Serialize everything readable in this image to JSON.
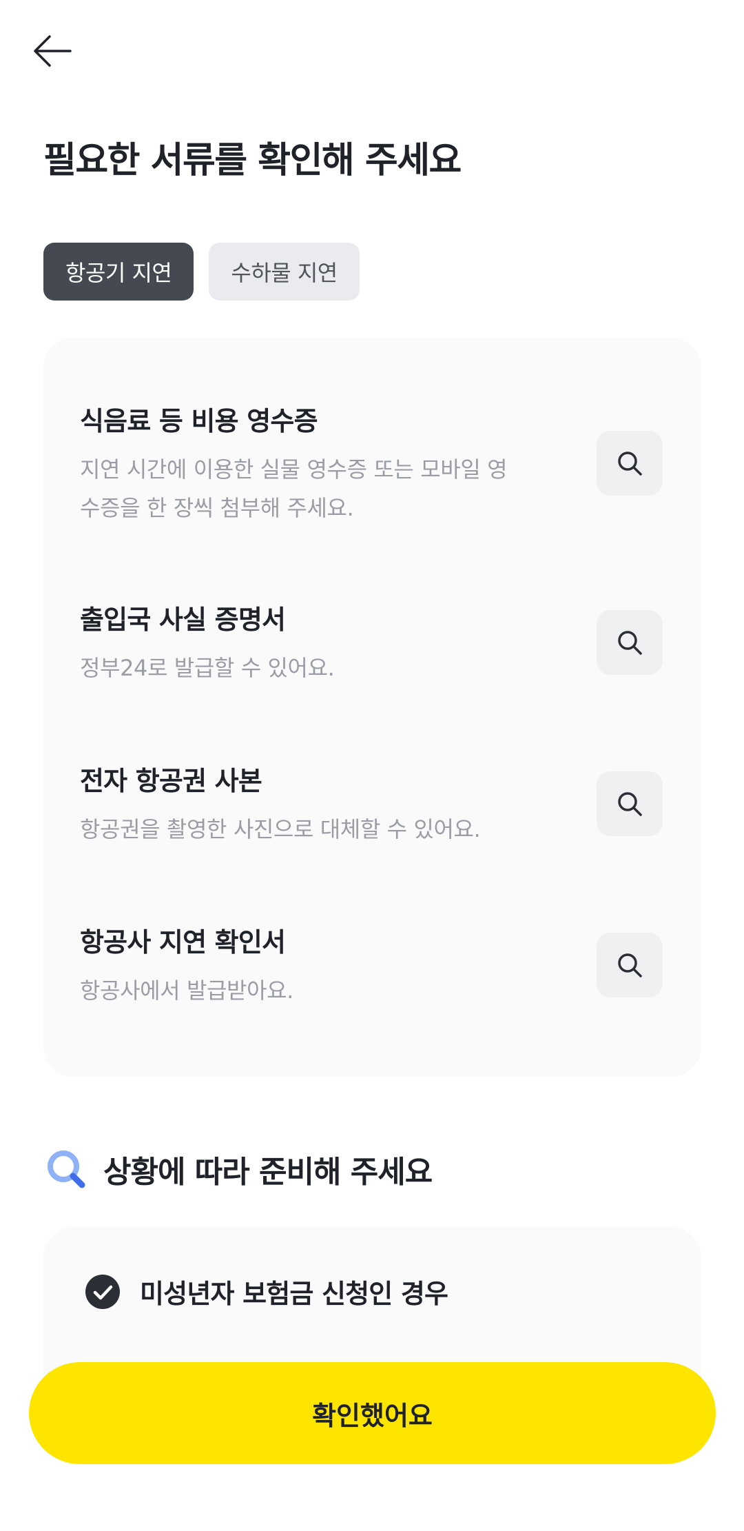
{
  "header": {
    "back_icon": "arrow-left-icon",
    "title": "필요한 서류를 확인해 주세요"
  },
  "tabs": [
    {
      "label": "항공기 지연",
      "selected": true
    },
    {
      "label": "수하물 지연",
      "selected": false
    }
  ],
  "documents": [
    {
      "title": "식음료 등 비용 영수증",
      "desc": "지연 시간에 이용한 실물 영수증 또는 모바일 영수증을 한 장씩 첨부해 주세요.",
      "icon": "search-icon"
    },
    {
      "title": "출입국 사실 증명서",
      "desc": "정부24로 발급할 수 있어요.",
      "icon": "search-icon"
    },
    {
      "title": "전자 항공권 사본",
      "desc": "항공권을 촬영한 사진으로 대체할 수 있어요.",
      "icon": "search-icon"
    },
    {
      "title": "항공사 지연 확인서",
      "desc": "항공사에서 발급받아요.",
      "icon": "search-icon"
    }
  ],
  "conditions": {
    "title": "상황에 따라 준비해 주세요",
    "icon": "magnifier-icon",
    "items": [
      {
        "label": "미성년자 보험금 신청인 경우",
        "icon": "check-circle-icon"
      }
    ]
  },
  "footer": {
    "confirm_label": "확인했어요"
  },
  "colors": {
    "accent": "#fee500",
    "tab_active": "#454a52",
    "tab_inactive": "#e9ebee",
    "card_bg": "#fafafa",
    "icon_blue": "#7ea6f5"
  }
}
